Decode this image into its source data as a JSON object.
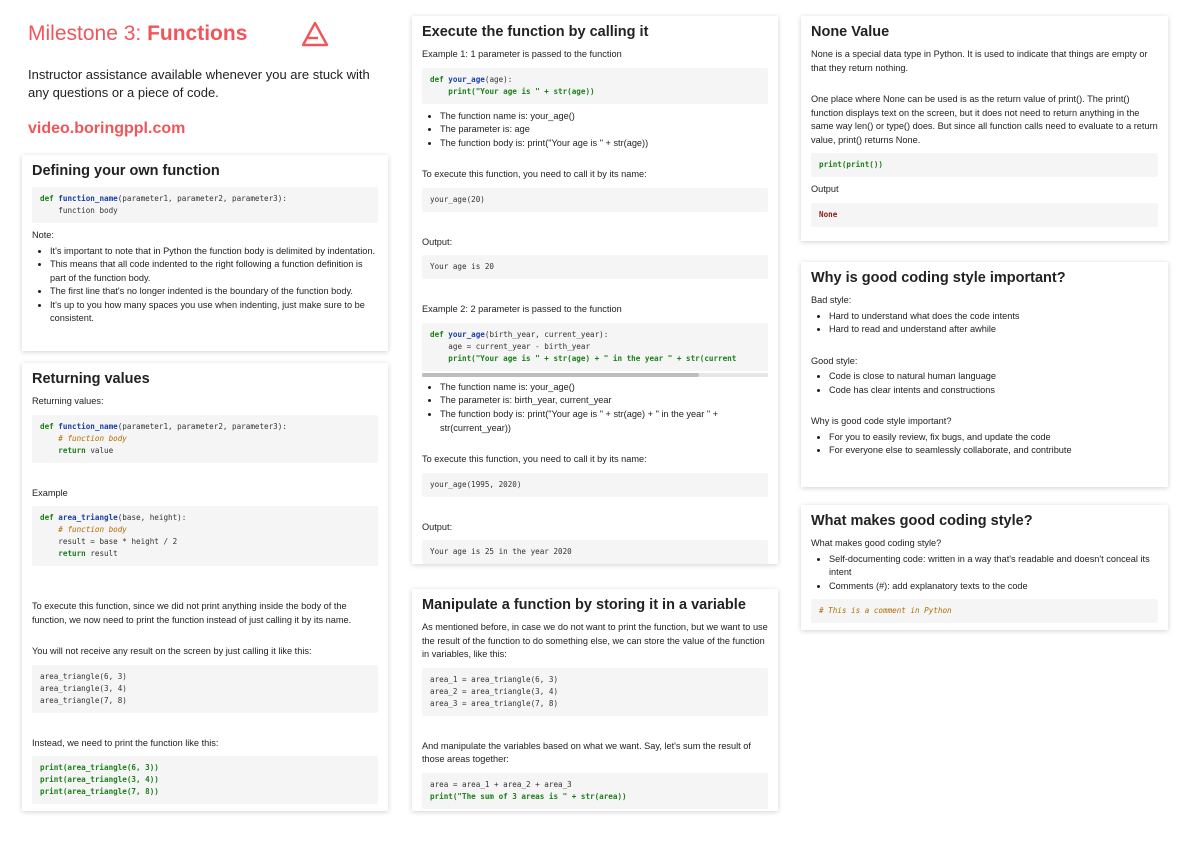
{
  "header": {
    "title_prefix": "Milestone 3: ",
    "title_strong": "Functions",
    "description": "Instructor assistance available whenever you are stuck with any questions or a piece of code.",
    "link": "video.boringppl.com",
    "accent_color": "#f0555a"
  },
  "defining": {
    "title": "Defining your own function",
    "note_label": "Note:",
    "bullets": [
      "It's important to note that in Python the function body is delimited by indentation.",
      "This means that all code indented to the right following a function definition is part of the function body.",
      "The first line that's no longer indented is the boundary of the function body.",
      "It's up to you how many spaces you use when indenting, just make sure to be consistent."
    ]
  },
  "returning": {
    "title": "Returning values",
    "label1": "Returning values:",
    "label2": "Example",
    "para1": "To execute this function, since we did not print anything inside the body of the function, we now need to print the function instead of just calling it by its name.",
    "para2": "You will not receive any result on the screen by just calling it like this:",
    "para3": "Instead, we need to print the function like this:"
  },
  "execute": {
    "title": "Execute the function by calling it",
    "ex1_label": "Example 1: 1 parameter is passed to the function",
    "ex1_bullets": [
      "The function name is: your_age()",
      "The parameter is: age",
      "The function body is: print(\"Your age is \" + str(age))"
    ],
    "call_label1": "To execute this function, you need to call it by its name:",
    "output_label1": "Output:",
    "ex2_label": "Example 2: 2 parameter is passed to the function",
    "ex2_bullets": [
      "The function name is: your_age()",
      "The parameter is: birth_year, current_year",
      "The function body is: print(\"Your age is \" + str(age) + \" in the year \" + str(current_year))"
    ],
    "call_label2": "To execute this function, you need to call it by its name:",
    "output_label2": "Output:"
  },
  "manipulate": {
    "title": "Manipulate a function by storing it in a variable",
    "para1": "As mentioned before, in case we do not want to print the function, but we want to use the result of the function to do something else, we can store the value of the function in variables, like this:",
    "para2": "And manipulate the variables based on what we want. Say, let's sum the result of those areas together:"
  },
  "none_value": {
    "title": "None Value",
    "para1": "None is a special data type in Python. It is used to indicate that things are empty or that they return nothing.",
    "para2": "One place where None can be used is as the return value of print(). The print() function displays text on the screen, but it does not need to return anything in the same way len() or type() does. But since all function calls need to evaluate to a return value, print() returns None.",
    "output_label": "Output"
  },
  "good_style": {
    "title": "Why is good coding style important?",
    "bad_label": "Bad style:",
    "bad_bullets": [
      "Hard to understand what does the code intents",
      "Hard to read and understand after awhile"
    ],
    "good_label": "Good style:",
    "good_bullets": [
      "Code is close to natural human language",
      "Code has clear intents and constructions"
    ],
    "why_label": "Why is good code style important?",
    "why_bullets": [
      "For you to easily review, fix bugs, and update the code",
      "For everyone else to seamlessly collaborate, and contribute"
    ]
  },
  "what_style": {
    "title": "What makes good coding style?",
    "label": "What makes good coding style?",
    "bullets": [
      "Self-documenting code: written in a way that's readable and doesn't conceal its intent",
      "Comments (#): add explanatory texts to the code"
    ]
  },
  "code": {
    "def_fn": "def",
    "function_name": "function_name",
    "params": "(parameter1, parameter2, parameter3):",
    "body": "function body",
    "comment_body": "# function body",
    "return_kw": "return",
    "return_val": "value",
    "area_triangle": "area_triangle",
    "area_params": "(base, height):",
    "result_assign": "result = base * height / 2",
    "return_result": "result",
    "calls": [
      "area_triangle(6, 3)",
      "area_triangle(3, 4)",
      "area_triangle(7, 8)"
    ],
    "print_calls": [
      "print(area_triangle(6, 3))",
      "print(area_triangle(3, 4))",
      "print(area_triangle(7, 8))"
    ],
    "your_age": "your_age",
    "age_param": "(age):",
    "age_print": "print(\"Your age is \" + str(age))",
    "call_20": "your_age(20)",
    "out_20": "Your age is 20",
    "age2_params": "(birth_year, current_year):",
    "age2_assign": "age = current_year - birth_year",
    "age2_print": "print(\"Your age is \" + str(age) + \" in the year \" + str(current",
    "call_1995": "your_age(1995, 2020)",
    "out_25": "Your age is 25 in the year 2020",
    "areas": [
      "area_1 = area_triangle(6, 3)",
      "area_2 = area_triangle(3, 4)",
      "area_3 = area_triangle(7, 8)"
    ],
    "area_sum": "area = area_1 + area_2 + area_3",
    "area_print": "print(\"The sum of 3 areas is \" + str(area))",
    "print_print": "print(print())",
    "none_out": "None",
    "py_comment": "# This is a comment in Python"
  }
}
